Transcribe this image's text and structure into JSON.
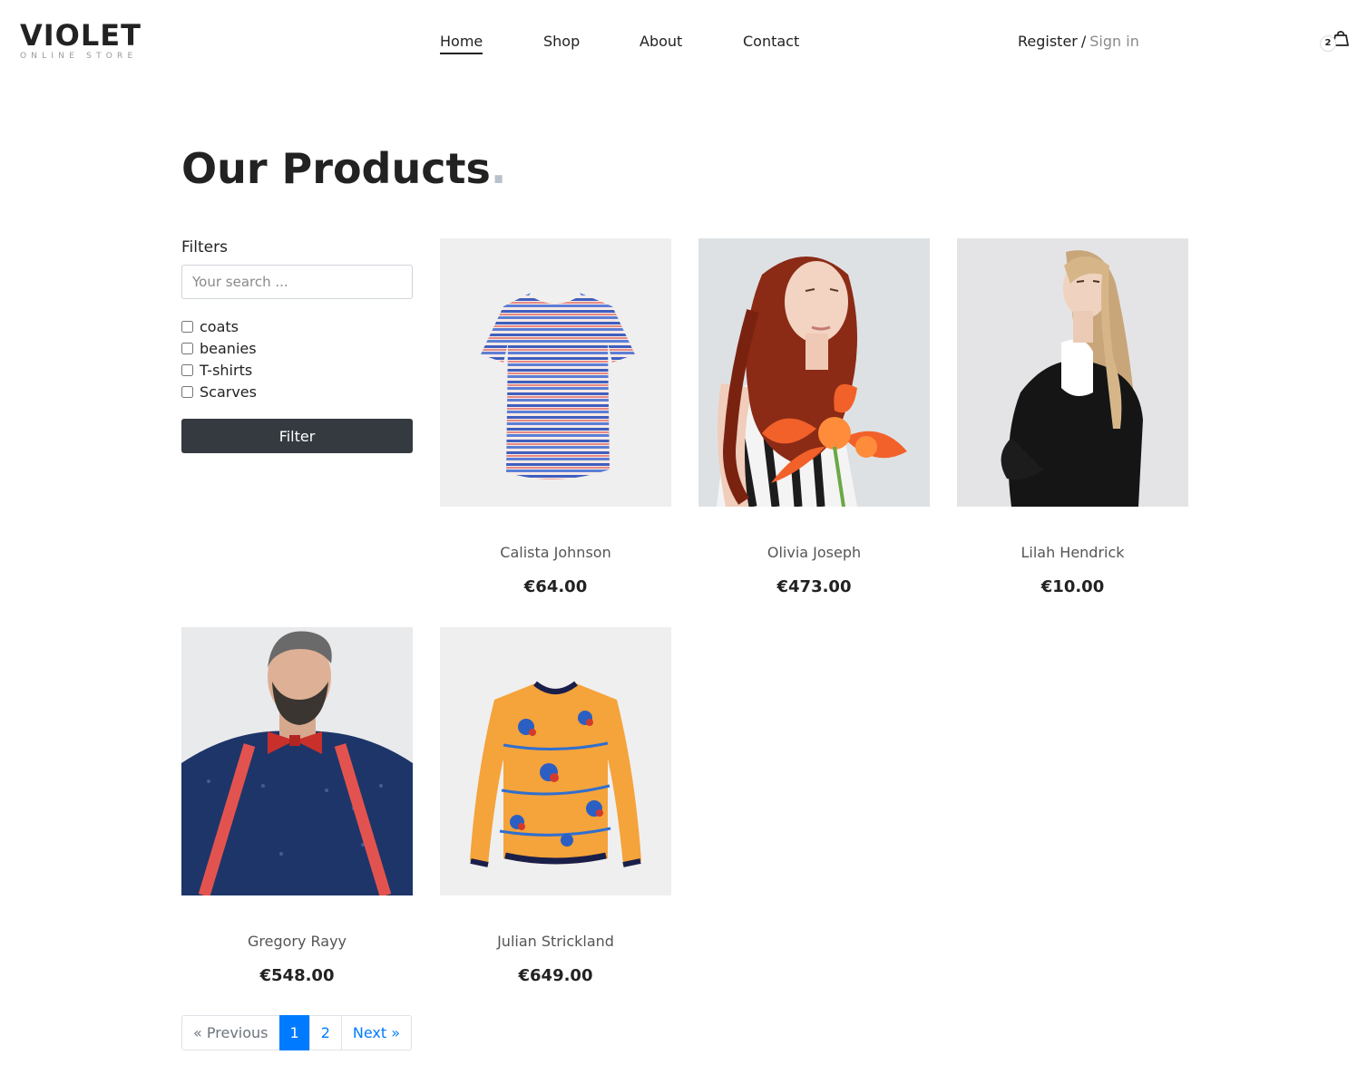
{
  "brand": {
    "name": "VIOLET",
    "tagline": "ONLINE STORE"
  },
  "nav": {
    "items": [
      {
        "label": "Home",
        "active": true
      },
      {
        "label": "Shop",
        "active": false
      },
      {
        "label": "About",
        "active": false
      },
      {
        "label": "Contact",
        "active": false
      }
    ]
  },
  "auth": {
    "register": "Register",
    "separator": "/",
    "signin": "Sign in"
  },
  "cart": {
    "count": "2",
    "icon": "shopping-bag-icon"
  },
  "page": {
    "title": "Our Products",
    "title_dot": ".",
    "accent_dot_color": "#b8c2cc"
  },
  "filters": {
    "title": "Filters",
    "search_placeholder": "Your search ...",
    "options": [
      {
        "label": "coats",
        "checked": false
      },
      {
        "label": "beanies",
        "checked": false
      },
      {
        "label": "T-shirts",
        "checked": false
      },
      {
        "label": "Scarves",
        "checked": false
      }
    ],
    "button_label": "Filter",
    "button_color": "#343a40"
  },
  "products": [
    {
      "name": "Calista Johnson",
      "price": "€64.00"
    },
    {
      "name": "Olivia Joseph",
      "price": "€473.00"
    },
    {
      "name": "Lilah Hendrick",
      "price": "€10.00"
    },
    {
      "name": "Gregory Rayy",
      "price": "€548.00"
    },
    {
      "name": "Julian Strickland",
      "price": "€649.00"
    }
  ],
  "pagination": {
    "previous": "« Previous",
    "pages": [
      "1",
      "2"
    ],
    "current": "1",
    "next": "Next »",
    "accent_color": "#007bff"
  }
}
